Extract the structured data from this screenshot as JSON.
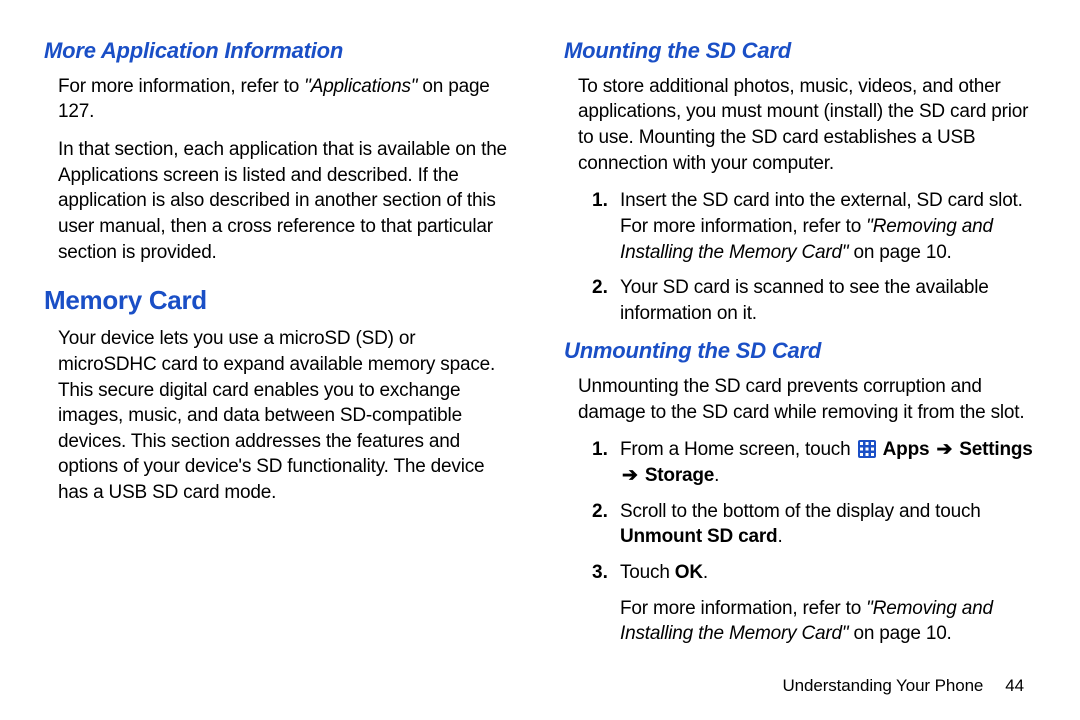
{
  "left": {
    "heading_more": "More Application Information",
    "para_more_1a": "For more information, refer to ",
    "para_more_1b": "\"Applications\"",
    "para_more_1c": " on page 127.",
    "para_more_2": "In that section, each application that is available on the Applications screen is listed and described. If the application is also described in another section of this user manual, then a cross reference to that particular section is provided.",
    "heading_memory": "Memory Card",
    "para_memory": "Your device lets you use a microSD (SD) or microSDHC card to expand available memory space. This secure digital card enables you to exchange images, music, and data between SD-compatible devices. This section addresses the features and options of your device's SD functionality. The device has a USB SD card mode."
  },
  "right": {
    "heading_mount": "Mounting the SD Card",
    "para_mount": "To store additional photos, music, videos, and other applications, you must mount (install) the SD card prior to use. Mounting the SD card establishes a USB connection with your computer.",
    "mount_steps": [
      {
        "num": "1.",
        "a": "Insert the SD card into the external, SD card slot. For more information, refer to ",
        "b": "\"Removing and Installing the Memory Card\"",
        "c": " on page 10."
      },
      {
        "num": "2.",
        "a": "Your SD card is scanned to see the available information on it."
      }
    ],
    "heading_unmount": "Unmounting the SD Card",
    "para_unmount": "Unmounting the SD card prevents corruption and damage to the SD card while removing it from the slot.",
    "unmount_steps": {
      "s1": {
        "num": "1.",
        "a": "From a Home screen, touch ",
        "apps": "Apps",
        "arrow": "➔",
        "settings": "Settings",
        "storage": "Storage",
        "dot": "."
      },
      "s2": {
        "num": "2.",
        "a": "Scroll to the bottom of the display and touch ",
        "b": "Unmount SD card",
        "c": "."
      },
      "s3": {
        "num": "3.",
        "a": "Touch ",
        "b": "OK",
        "c": "."
      },
      "note": {
        "a": "For more information, refer to ",
        "b": "\"Removing and Installing the Memory Card\"",
        "c": " on page 10."
      }
    }
  },
  "footer": {
    "section": "Understanding Your Phone",
    "page": "44"
  }
}
